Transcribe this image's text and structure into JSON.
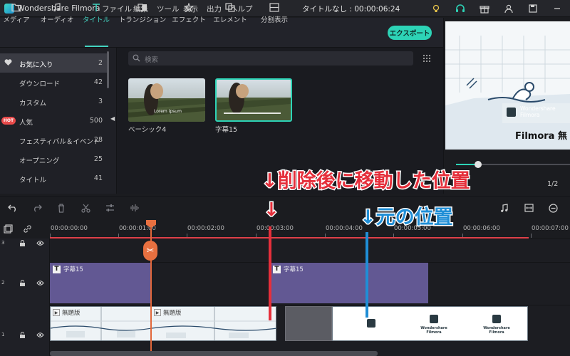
{
  "app": {
    "name": "Wondershare Filmora",
    "title": "タイトルなし : 00:00:06:24"
  },
  "menu": [
    "ファイル",
    "編集",
    "ツール",
    "表示",
    "出力",
    "ヘルプ"
  ],
  "tabs": [
    {
      "label": "メディア",
      "icon": "folder-icon"
    },
    {
      "label": "オーディオ",
      "icon": "music-note-icon"
    },
    {
      "label": "タイトル",
      "icon": "text-icon",
      "active": true
    },
    {
      "label": "トランジション",
      "icon": "transition-icon"
    },
    {
      "label": "エフェクト",
      "icon": "effects-icon"
    },
    {
      "label": "エレメント",
      "icon": "elements-icon"
    },
    {
      "label": "分割表示",
      "icon": "split-screen-icon"
    }
  ],
  "export_label": "エクスポート",
  "sidebar": {
    "items": [
      {
        "label": "お気に入り",
        "count": "2",
        "active": true
      },
      {
        "label": "ダウンロード",
        "count": "42"
      },
      {
        "label": "カスタム",
        "count": "3"
      },
      {
        "label": "人気",
        "count": "500",
        "badge": "HOT"
      },
      {
        "label": "フェスティバル＆イベント",
        "count": "28"
      },
      {
        "label": "オープニング",
        "count": "25"
      },
      {
        "label": "タイトル",
        "count": "41"
      }
    ]
  },
  "search": {
    "placeholder": "検索"
  },
  "thumbnails": [
    {
      "caption": "ベーシック4",
      "overlay": "Lorem ipsum"
    },
    {
      "caption": "字幕15",
      "selected": true
    }
  ],
  "preview": {
    "watermark_brand": "Wondershare",
    "watermark_product": "Filmora",
    "overlay_text": "Filmora 無",
    "scale": "1/2"
  },
  "timeline": {
    "ticks": [
      "00:00:00:00",
      "00:00:01:00",
      "00:00:02:00",
      "00:00:03:00",
      "00:00:04:00",
      "00:00:05:00",
      "00:00:06:00",
      "00:00:07:00"
    ],
    "tracks": [
      "3",
      "2",
      "1"
    ],
    "title_clip_1": "字幕15",
    "title_clip_2": "字幕15",
    "video_clip_label_a": "無題版",
    "video_clip_label_b": "無題版",
    "brand_caption": "Wondershare Filmora"
  },
  "annotations": {
    "red": "↓削除後に移動した位置",
    "red_arrow": "↓",
    "blue": "↓元の位置"
  },
  "colors": {
    "accent": "#2dd3b6",
    "title_clip": "#625893",
    "red": "#e52f3b",
    "blue": "#1f8ed6",
    "playhead": "#e87040"
  }
}
